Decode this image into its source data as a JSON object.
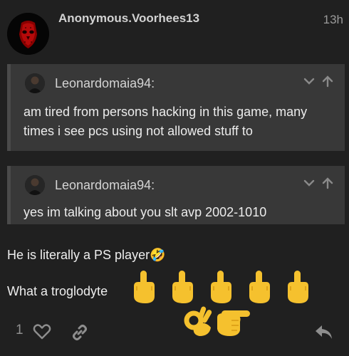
{
  "post": {
    "username": "Anonymous.Voorhees13",
    "time": "13h",
    "quotes": [
      {
        "author": "Leonardomaia94:",
        "text": "am tired from persons hacking in this game, many times i see pcs using not allowed stuff to"
      },
      {
        "author": "Leonardomaia94:",
        "text": "yes im talking about you slt avp 2002-1010"
      }
    ],
    "lines": [
      "He is literally a PS player🤣",
      "What a troglodyte"
    ],
    "like_count": "1"
  },
  "icons": {
    "expand": "chevron-down-icon",
    "jump": "arrow-up-icon",
    "like": "heart-icon",
    "share": "link-icon",
    "reply": "reply-icon",
    "emoji_middle_finger": "middle-finger-emoji",
    "emoji_ok": "ok-hand-emoji",
    "emoji_point": "pointing-right-emoji"
  },
  "colors": {
    "background": "#202020",
    "quote_bg": "#383838",
    "emoji_yellow": "#f5c12e"
  }
}
